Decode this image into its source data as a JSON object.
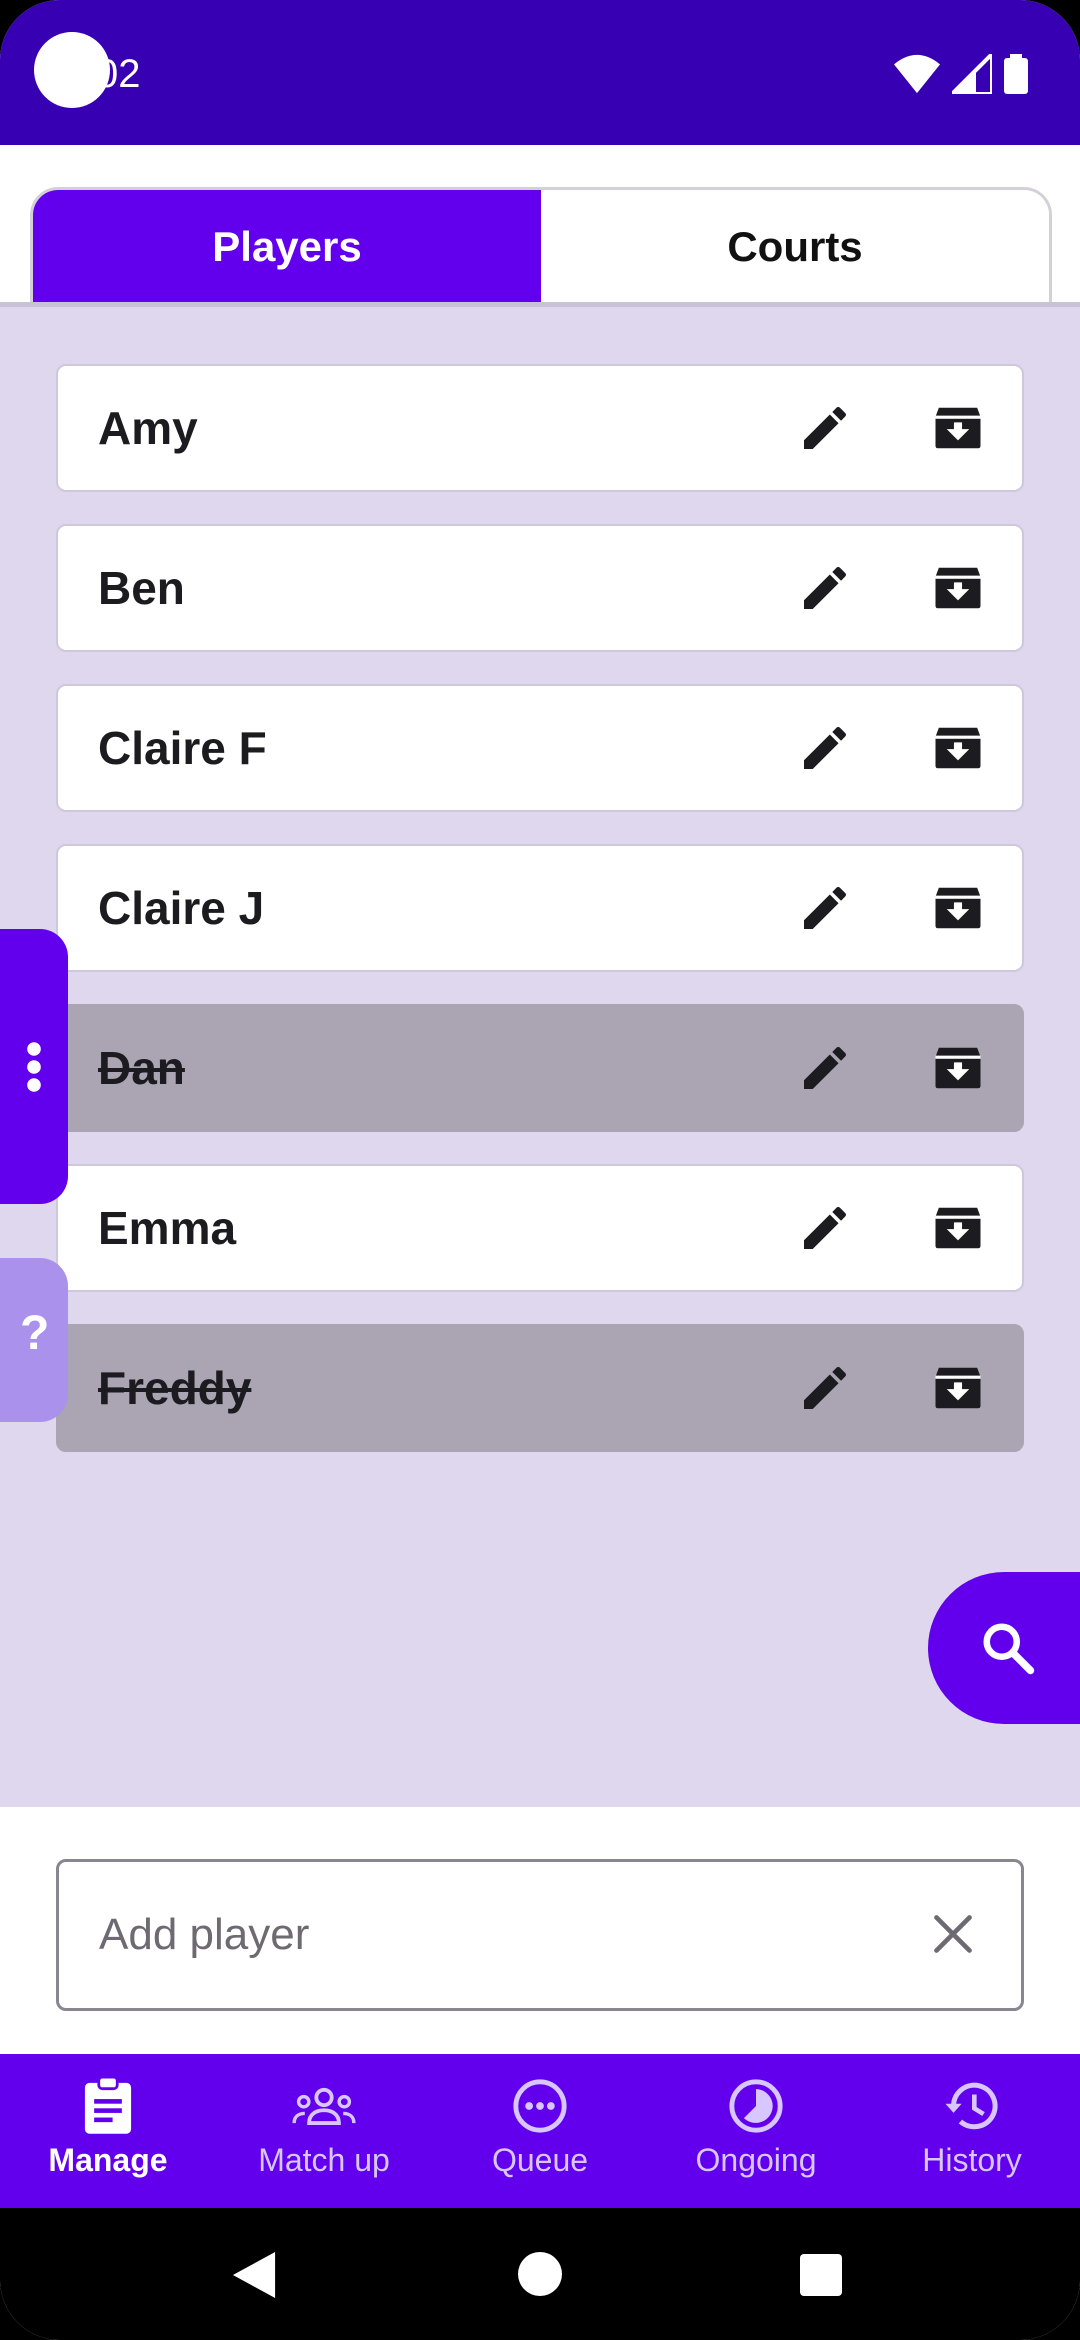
{
  "status_bar": {
    "time": "02"
  },
  "tabs": [
    {
      "label": "Players",
      "active": true
    },
    {
      "label": "Courts",
      "active": false
    }
  ],
  "players": [
    {
      "name": "Amy",
      "archived": false
    },
    {
      "name": "Ben",
      "archived": false
    },
    {
      "name": "Claire F",
      "archived": false
    },
    {
      "name": "Claire J",
      "archived": false
    },
    {
      "name": "Dan",
      "archived": true
    },
    {
      "name": "Emma",
      "archived": false
    },
    {
      "name": "Freddy",
      "archived": true
    }
  ],
  "side": {
    "menu_icon": "more-vert-icon",
    "help_label": "?"
  },
  "fab": {
    "icon": "search-icon"
  },
  "add_player": {
    "placeholder": "Add player",
    "value": ""
  },
  "bottom_nav": [
    {
      "label": "Manage",
      "icon": "clipboard-icon",
      "active": true
    },
    {
      "label": "Match up",
      "icon": "groups-icon",
      "active": false
    },
    {
      "label": "Queue",
      "icon": "pending-icon",
      "active": false
    },
    {
      "label": "Ongoing",
      "icon": "timelapse-icon",
      "active": false
    },
    {
      "label": "History",
      "icon": "history-icon",
      "active": false
    }
  ],
  "colors": {
    "status_bar": "#3700b3",
    "primary": "#6200ee",
    "list_background": "#ded7ee",
    "archived_row": "#aaa4b3"
  }
}
